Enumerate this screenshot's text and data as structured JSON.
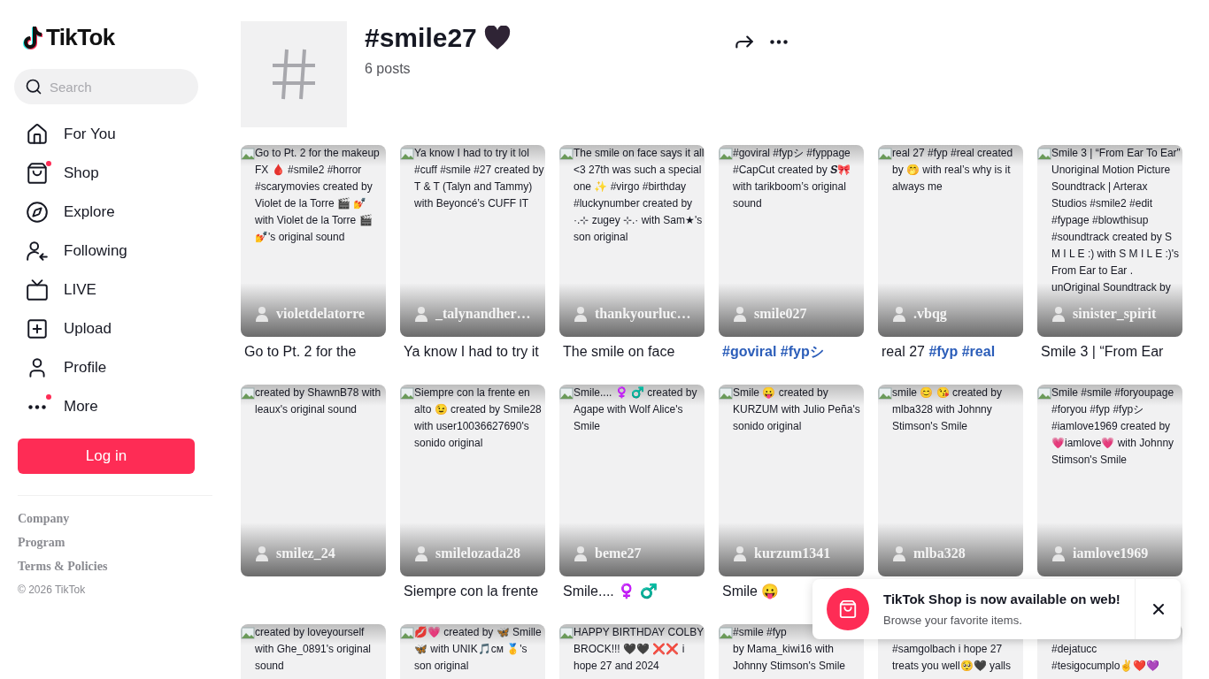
{
  "logo": {
    "text": "TikTok"
  },
  "search": {
    "placeholder": "Search"
  },
  "nav": [
    {
      "label": "For You",
      "dot": false
    },
    {
      "label": "Shop",
      "dot": true
    },
    {
      "label": "Explore",
      "dot": false
    },
    {
      "label": "Following",
      "dot": false
    },
    {
      "label": "LIVE",
      "dot": false
    },
    {
      "label": "Upload",
      "dot": false
    },
    {
      "label": "Profile",
      "dot": false
    },
    {
      "label": "More",
      "dot": true
    }
  ],
  "login_button": "Log in",
  "footer_links": [
    "Company",
    "Program",
    "Terms & Policies"
  ],
  "copyright": "© 2026 TikTok",
  "hashtag": {
    "title": "#smile27",
    "posts": "6 posts"
  },
  "videos": [
    {
      "alt": "Go to Pt. 2 for the makeup FX 🩸 #smile2 #horror #scarymovies created by Violet de la Torre 🎬 💅 with Violet de la Torre 🎬 💅's original sound",
      "username": "violetdelatorre",
      "caption": [
        {
          "text": "Go to Pt. 2 for the",
          "kind": "plain"
        }
      ]
    },
    {
      "alt": "Ya know I had to try it lol #cuff #smile #27 created by T & T (Talyn and Tammy) with Beyoncé’s CUFF IT",
      "username": "_talynandher…",
      "caption": [
        {
          "text": "Ya know I had to try it",
          "kind": "plain"
        }
      ]
    },
    {
      "alt": "The smile on face says it all <3 27th was such a special one ✨ #virgo #birthday #luckynumber created by ·.⊹ zugey ⊹.· with Sam★'s son original",
      "username": "thankyourluc…",
      "caption": [
        {
          "text": "The smile on face",
          "kind": "plain"
        }
      ]
    },
    {
      "alt": "#goviral #fypシ #fyppage #CapCut created by 𝑺🎀 with tarikboom’s original sound",
      "username": "smile027",
      "caption": [
        {
          "text": "#goviral #fypシ",
          "kind": "hashtag"
        }
      ]
    },
    {
      "alt": "real 27 #fyp #real created by 🤭 with real’s why is it always me",
      "username": ".vbqg",
      "caption": [
        {
          "text": "real 27 ",
          "kind": "plain"
        },
        {
          "text": "#fyp #real",
          "kind": "hashtag"
        }
      ]
    },
    {
      "alt": "Smile 3 | “From Ear To Ear” Unoriginal Motion Picture Soundtrack | Arterax Studios #smile2 #edit #fypage #blowthisup #soundtrack created by S M I L E :) with S M I L E :)'s From Ear to Ear . unOriginal Soundtrack by",
      "username": "sinister_spirit",
      "caption": [
        {
          "text": "Smile 3 | “From Ear",
          "kind": "plain"
        }
      ]
    },
    {
      "alt": "created by ShawnB78 with leaux's original sound",
      "username": "smilez_24"
    },
    {
      "alt": "Siempre con la frente en alto 😉 created by Smile28 with user10036627690's sonido original",
      "username": "smilelozada28",
      "caption": [
        {
          "text": "Siempre con la frente",
          "kind": "plain"
        }
      ]
    },
    {
      "alt": "Smile.... ♀️ ♂️ created by Agape with Wolf Alice's Smile",
      "username": "beme27",
      "caption": [
        {
          "text": "Smile.... ♀️ ♂️",
          "kind": "plain"
        }
      ]
    },
    {
      "alt": "Smile 😛 created by KURZUM with Julio Peña's sonido original",
      "username": "kurzum1341",
      "caption": [
        {
          "text": "Smile 😛",
          "kind": "plain"
        }
      ]
    },
    {
      "alt": "smile 😊 😘 created by mlba328 with Johnny Stimson's Smile",
      "username": "mlba328"
    },
    {
      "alt": "Smile #smile #foryoupage #foryou #fyp #fypシ #iamlove1969 created by 💗iamlove💗 with Johnny Stimson's Smile",
      "username": "iamlove1969"
    },
    {
      "alt": "created by loveyourself with Ghe_0891's original sound"
    },
    {
      "alt": "💋💗 created by 🦋 Smille 🦋 with UNIK🎵ᴄᴍ 🥇's son original"
    },
    {
      "alt": "HAPPY BIRTHDAY COLBY BROCK!!! 🖤🖤 ❌❌ i hope 27 and 2024"
    },
    {
      "alt_lines": [
        "#smile #fyp",
        "by Mama_kiwi16 with",
        "Johnny Stimson's Smile"
      ],
      "first_line_covered": false
    },
    {
      "alt_lines": [
        "#samgolbach i hope 27",
        "treats you well🥺🖤 yalls"
      ],
      "first_line_covered": true
    },
    {
      "alt_lines": [
        "#dejatucc",
        "#tesigocumplo✌️❤️💜"
      ],
      "first_line_covered": true
    }
  ],
  "toast": {
    "title": "TikTok Shop is now available on web!",
    "message": "Browse your favorite items."
  }
}
